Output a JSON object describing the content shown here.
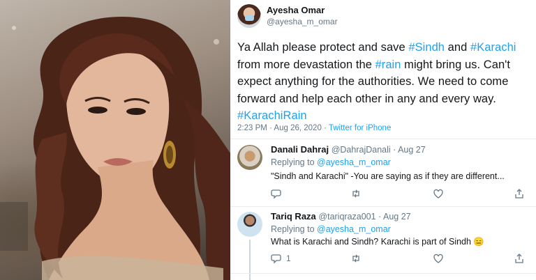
{
  "tweet": {
    "author": {
      "display_name": "Ayesha Omar",
      "handle": "@ayesha_m_omar",
      "avatar_icon": "avatar-icon"
    },
    "text_parts": [
      "Ya Allah please protect and save ",
      "#Sindh",
      " and ",
      "#Karachi",
      " from more devastation the ",
      "#rain",
      " might bring us. Can't expect anything for the authorities. We need to come forward and help each other in any and every way. ",
      "#KarachiRain"
    ],
    "timestamp": "2:23 PM · Aug 26, 2020 · ",
    "source": "Twitter for iPhone"
  },
  "replies": [
    {
      "name": "Danali Dahraj",
      "handle": "@DahrajDanali",
      "time": " · Aug 27",
      "replying_label": "Replying to ",
      "replying_to": "@ayesha_m_omar",
      "text": "\"Sindh and Karachi\" -You are saying as if they are different...",
      "reply_count": "",
      "retweet_count": ""
    },
    {
      "name": "Tariq Raza",
      "handle": "@tariqraza001",
      "time": " · Aug 27",
      "replying_label": "Replying to ",
      "replying_to": "@ayesha_m_omar",
      "text": "What is Karachi and Sindh? Karachi is part of Sindh 😑",
      "reply_count": "1",
      "retweet_count": ""
    }
  ],
  "colors": {
    "link": "#1da1f2",
    "muted": "#657786",
    "text": "#14171a",
    "divider": "#e6ecf0"
  },
  "icons": [
    "reply-icon",
    "retweet-icon",
    "like-icon",
    "share-icon"
  ]
}
